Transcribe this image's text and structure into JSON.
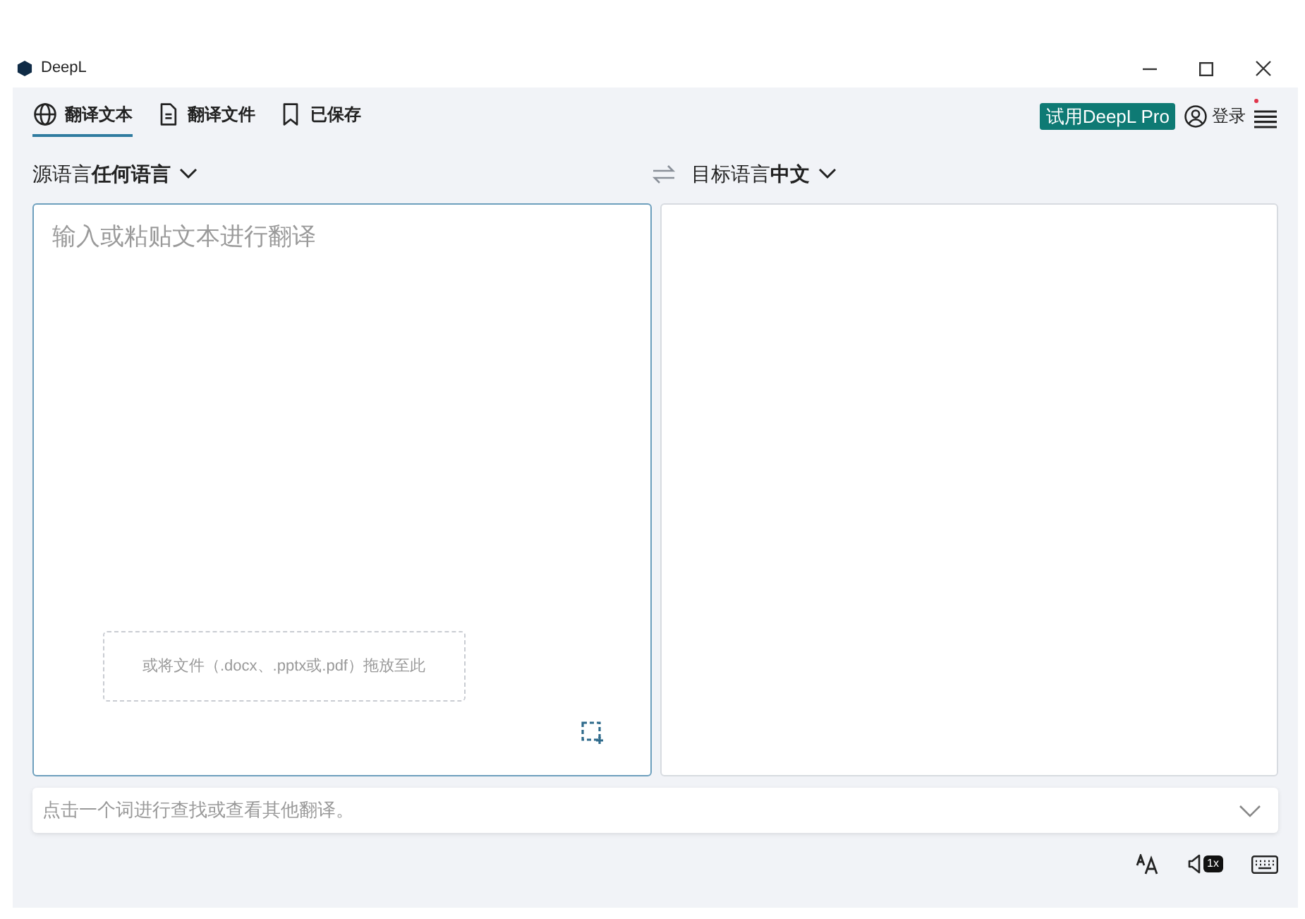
{
  "window": {
    "title": "DeepL"
  },
  "tabs": [
    {
      "label": "翻译文本",
      "kind": "globe",
      "selected": true
    },
    {
      "label": "翻译文件",
      "kind": "file",
      "selected": false
    },
    {
      "label": "已保存",
      "kind": "bookmark",
      "selected": false
    }
  ],
  "pro_button": "试用DeepL Pro",
  "login": "登录",
  "menu_badge": true,
  "source_language": "源语言**任何语言**",
  "target_language": "目标语言**中文**",
  "source": {
    "placeholder": "输入或粘贴文本进行翻译",
    "drop_hint": "或将文件（.docx、.pptx或.pdf）拖放至此"
  },
  "dictionary": {
    "placeholder": "点击一个词进行查找或查看其他翻译。"
  },
  "speed_badge": "1x"
}
